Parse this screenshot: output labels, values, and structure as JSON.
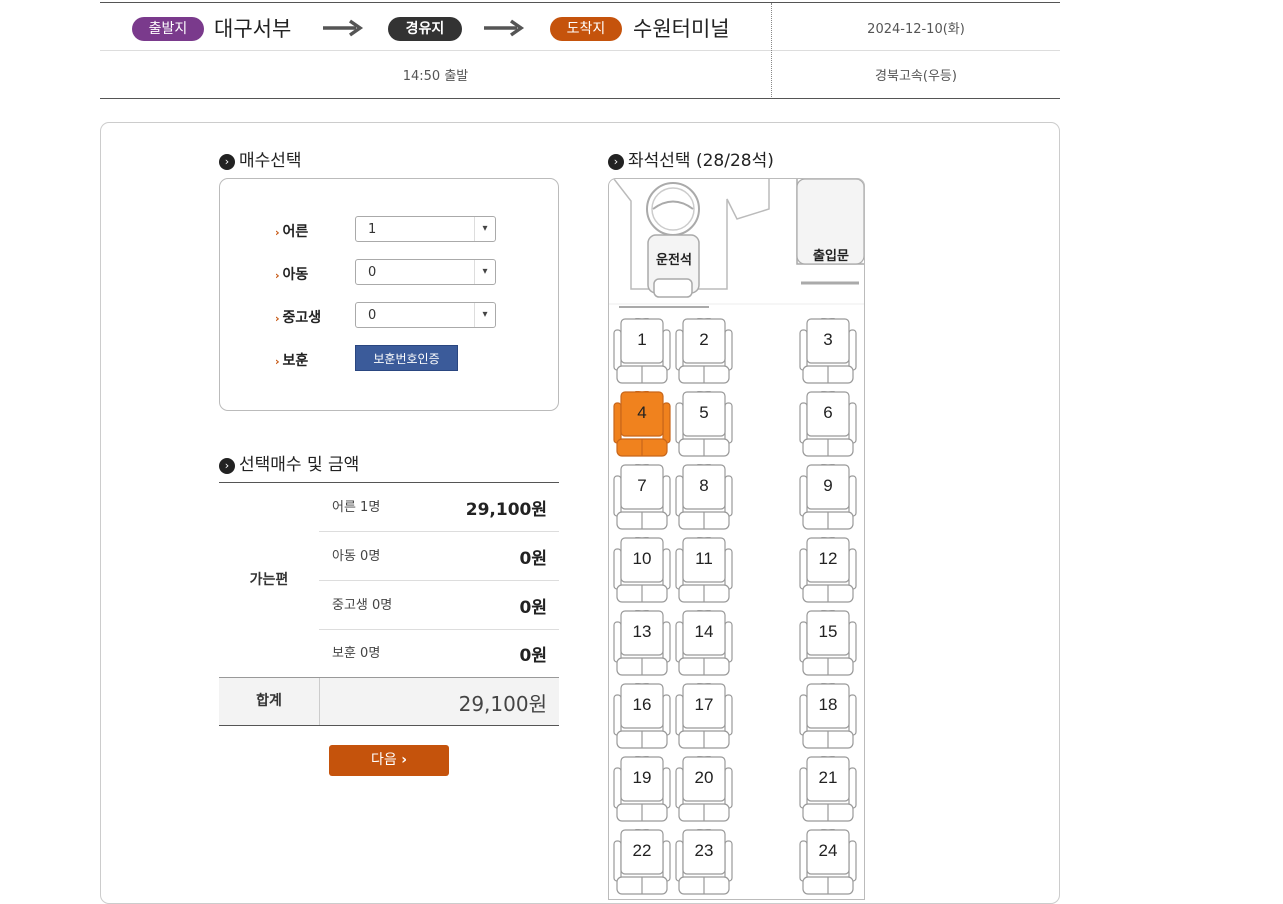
{
  "route": {
    "departure_badge": "출발지",
    "departure": "대구서부",
    "via_badge": "경유지",
    "arrival_badge": "도착지",
    "arrival": "수원터미널",
    "date": "2024-12-10(화)",
    "departure_time": "14:50 출발",
    "company": "경북고속(우등)"
  },
  "quantity": {
    "title": "매수선택",
    "rows": [
      {
        "label": "어른",
        "value": "1"
      },
      {
        "label": "아동",
        "value": "0"
      },
      {
        "label": "중고생",
        "value": "0"
      }
    ],
    "veteran_label": "보훈",
    "veteran_button": "보훈번호인증"
  },
  "price": {
    "title": "선택매수 및 금액",
    "group_label": "가는편",
    "rows": [
      {
        "label": "어른 1명",
        "value": "29,100원"
      },
      {
        "label": "아동 0명",
        "value": "0원"
      },
      {
        "label": "중고생 0명",
        "value": "0원"
      },
      {
        "label": "보훈 0명",
        "value": "0원"
      }
    ],
    "total_label": "합계",
    "total_value": "29,100원"
  },
  "next_button": "다음",
  "seatmap": {
    "title": "좌석선택 (28/28석)",
    "driver_label": "운전석",
    "door_label": "출입문",
    "selected_seat": "4",
    "seats": [
      "1",
      "2",
      "3",
      "4",
      "5",
      "6",
      "7",
      "8",
      "9",
      "10",
      "11",
      "12",
      "13",
      "14",
      "15",
      "16",
      "17",
      "18",
      "19",
      "20",
      "21",
      "22",
      "23",
      "24"
    ]
  },
  "colors": {
    "departure_badge": "#7a3a8c",
    "via_badge": "#333333",
    "arrival_badge": "#c5530c",
    "selected_seat": "#f0821e",
    "veteran_button": "#3b5b9a",
    "next_button": "#c5530c"
  },
  "icons": {
    "route_arrow": "long-right-arrow-icon",
    "section_bullet": "circle-chevron-right-icon",
    "select_arrow": "chevron-down-icon",
    "next_arrow": "chevron-right-icon"
  }
}
